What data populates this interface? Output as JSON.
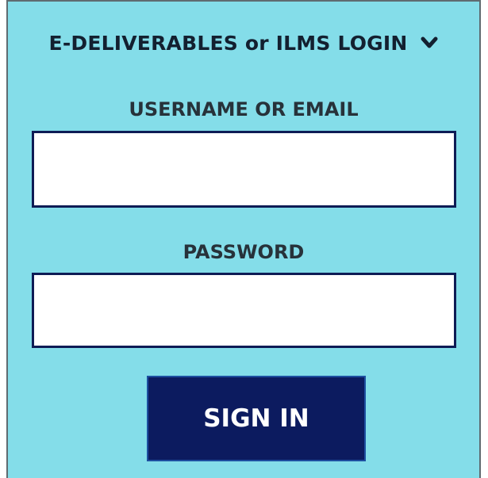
{
  "login": {
    "title": "E-DELIVERABLES or ILMS LOGIN",
    "toggle_icon": "chevron-down-icon",
    "username_label": "USERNAME OR EMAIL",
    "username_value": "",
    "password_label": "PASSWORD",
    "password_value": "",
    "submit_label": "SIGN IN"
  },
  "colors": {
    "panel_bg": "#84dde9",
    "text_dark": "#132030",
    "field_border": "#0e1c55",
    "button_bg": "#0c1b5f",
    "button_text": "#ffffff"
  }
}
